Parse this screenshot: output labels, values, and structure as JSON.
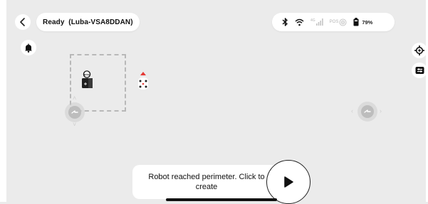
{
  "header": {
    "title": "Ready  (Luba-VSA8DDAN)",
    "back_icon": "chevron-left-icon"
  },
  "status_bar": {
    "icons": [
      "bluetooth-icon",
      "wifi-icon",
      "cellular-4g-icon",
      "rtk-pos-icon",
      "battery-icon"
    ],
    "network_label": "4G",
    "pos_label": "POS",
    "battery": "79%"
  },
  "map": {
    "bell_icon": "bell-icon",
    "locate_icon": "crosshair-icon",
    "layers_icon": "map-layers-icon",
    "station_label": "RTK"
  },
  "toast": {
    "line1": "Robot reached perimeter. Click to",
    "line2": "create"
  },
  "controls": {
    "play_icon": "play-icon"
  },
  "colors": {
    "background": "#ebebeb",
    "robot_accent": "#e53935",
    "boundary": "#b8b8b8"
  }
}
